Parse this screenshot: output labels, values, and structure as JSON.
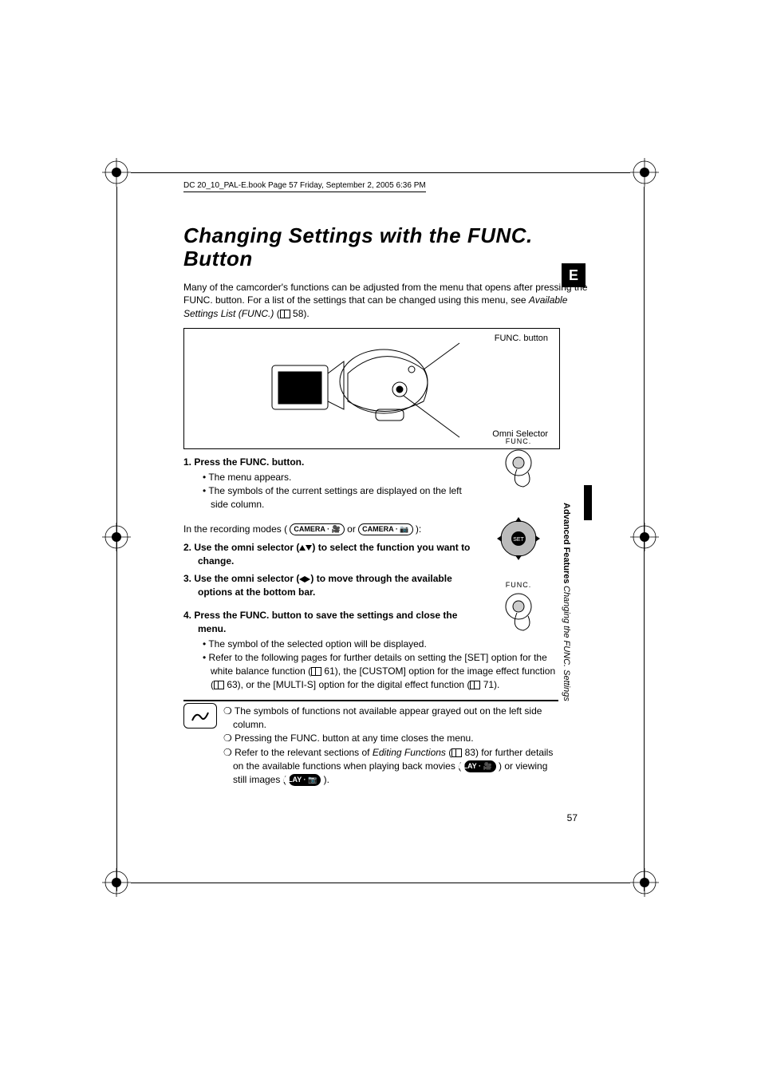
{
  "running_head": "DC 20_10_PAL-E.book  Page 57  Friday, September 2, 2005  6:36 PM",
  "title": "Changing Settings with the FUNC. Button",
  "intro_pre": "Many of the camcorder's functions can be adjusted from the menu that opens after pressing the FUNC. button. For a list of the settings that can be changed using this menu, see ",
  "intro_ital": "Available Settings List (FUNC.)",
  "intro_post_ref": " 58).",
  "diagram": {
    "label_func": "FUNC. button",
    "label_omni": "Omni Selector"
  },
  "step1": {
    "head": "1.  Press the FUNC. button.",
    "b1": "• The menu appears.",
    "b2": "• The symbols of the current settings are displayed on the left side column."
  },
  "recmode_pre": "In the recording modes (",
  "recmode_badge1": "CAMERA · 🎥",
  "recmode_mid": " or ",
  "recmode_badge2": "CAMERA · 📷",
  "recmode_post": "):",
  "step2": {
    "head_pre": "2.  Use the omni selector (",
    "head_post": ") to select the function you want to change."
  },
  "step3": {
    "head_pre": "3.  Use the omni selector (",
    "head_post": ") to move through the available options at the bottom bar."
  },
  "step4": {
    "head": "4.  Press the FUNC. button to save the settings and close the menu.",
    "b1": "• The symbol of the selected option will be displayed.",
    "b2_pre": "• Refer to the following pages for further details on setting the [SET] option for the white balance function (",
    "b2_ref1": " 61), the [CUSTOM] option for the image effect function (",
    "b2_ref2": " 63), or the [MULTI-S] option for the digital effect function (",
    "b2_ref3": " 71)."
  },
  "notes": {
    "n1": "The symbols of functions not available appear grayed out on the left side column.",
    "n2": "Pressing the FUNC. button at any time closes the menu.",
    "n3_pre": "Refer to the relevant sections of ",
    "n3_ital": "Editing Functions",
    "n3_mid1": " (",
    "n3_ref": " 83) for further details on the available functions when playing back movies ( ",
    "n3_badge1": "PLAY · 🎥",
    "n3_mid2": " ) or viewing still images ( ",
    "n3_badge2": "PLAY · 📷",
    "n3_end": " )."
  },
  "side_tab": "E",
  "side_section": "Advanced Features",
  "side_sub": "Changing the FUNC. Settings",
  "page_number": "57",
  "illus": {
    "func_label": "FUNC.",
    "set_label": "SET"
  }
}
